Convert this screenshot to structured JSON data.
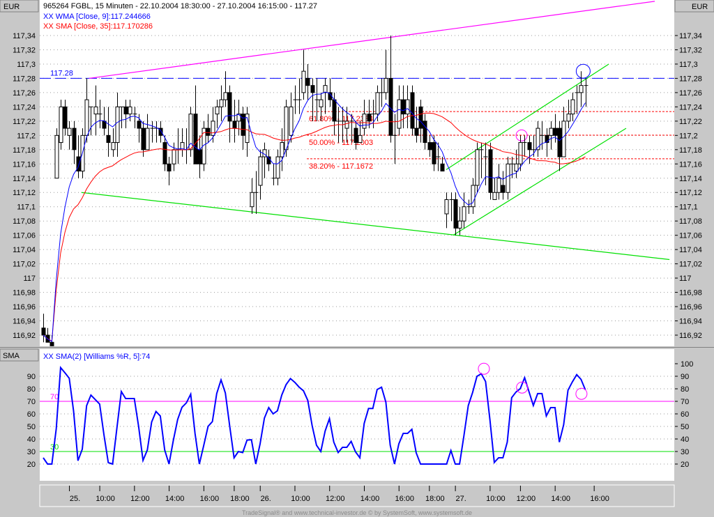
{
  "header": {
    "title": "965264  FGBL, 15 Minuten - 22.10.2004 18:30:00 - 27.10.2004 16:15:00 - 117.27",
    "wma_label": "XX WMA [Close, 9]:117.244666",
    "sma_label": "XX SMA [Close, 35]:117.170286",
    "currency_left": "EUR",
    "currency_right": "EUR",
    "lower_axis_label": "SMA",
    "lower_label": "XX SMA(2) [Williams %R, 5]:74"
  },
  "footer": "TradeSignal® and www.technical-investor.de © by SystemSoft, www.systemsoft.de",
  "colors": {
    "wma": "#0000ff",
    "sma": "#ff0000",
    "williams": "#0000ff",
    "resistance": "#ff00ff",
    "support": "#00e000",
    "fib": "#ff0000",
    "level_line": "#0000ff",
    "level70": "#ff00ff",
    "level30": "#00e000"
  },
  "chart_data": [
    {
      "type": "candlestick",
      "ylabel": "EUR",
      "ylim": [
        116.92,
        117.34
      ],
      "y_ticks": [
        "117,34",
        "117,32",
        "117,3",
        "117,28",
        "117,26",
        "117,24",
        "117,22",
        "117,2",
        "117,18",
        "117,16",
        "117,14",
        "117,12",
        "117,1",
        "117,08",
        "117,06",
        "117,04",
        "117,02",
        "117",
        "116,98",
        "116,96",
        "116,94",
        "116,92"
      ],
      "x_ticks": [
        {
          "label": "25.",
          "bar": 7
        },
        {
          "label": "10:00",
          "bar": 14
        },
        {
          "label": "12:00",
          "bar": 22
        },
        {
          "label": "14:00",
          "bar": 30
        },
        {
          "label": "16:00",
          "bar": 38
        },
        {
          "label": "18:00",
          "bar": 45
        },
        {
          "label": "26.",
          "bar": 51
        },
        {
          "label": "10:00",
          "bar": 59
        },
        {
          "label": "12:00",
          "bar": 67
        },
        {
          "label": "14:00",
          "bar": 75
        },
        {
          "label": "16:00",
          "bar": 83
        },
        {
          "label": "18:00",
          "bar": 90
        },
        {
          "label": "27.",
          "bar": 96
        },
        {
          "label": "10:00",
          "bar": 104
        },
        {
          "label": "12:00",
          "bar": 111
        },
        {
          "label": "14:00",
          "bar": 119
        },
        {
          "label": "16:00",
          "bar": 128
        }
      ],
      "ohlc": [
        [
          116.93,
          116.95,
          116.91,
          116.92
        ],
        [
          116.92,
          116.93,
          116.91,
          116.91
        ],
        [
          116.91,
          116.92,
          116.905,
          116.905
        ],
        [
          117.14,
          117.21,
          117.14,
          117.2
        ],
        [
          117.19,
          117.25,
          117.18,
          117.24
        ],
        [
          117.24,
          117.25,
          117.2,
          117.21
        ],
        [
          117.2,
          117.22,
          117.18,
          117.21
        ],
        [
          117.21,
          117.22,
          117.16,
          117.18
        ],
        [
          117.17,
          117.2,
          117.14,
          117.15
        ],
        [
          117.15,
          117.21,
          117.14,
          117.2
        ],
        [
          117.2,
          117.28,
          117.19,
          117.25
        ],
        [
          117.24,
          117.24,
          117.2,
          117.24
        ],
        [
          117.23,
          117.27,
          117.2,
          117.24
        ],
        [
          117.23,
          117.25,
          117.21,
          117.23
        ],
        [
          117.22,
          117.24,
          117.2,
          117.21
        ],
        [
          117.2,
          117.24,
          117.17,
          117.19
        ],
        [
          117.18,
          117.21,
          117.17,
          117.19
        ],
        [
          117.19,
          117.26,
          117.17,
          117.24
        ],
        [
          117.24,
          117.24,
          117.21,
          117.24
        ],
        [
          117.24,
          117.25,
          117.21,
          117.23
        ],
        [
          117.23,
          117.25,
          117.22,
          117.24
        ],
        [
          117.23,
          117.24,
          117.21,
          117.23
        ],
        [
          117.22,
          117.23,
          117.19,
          117.21
        ],
        [
          117.21,
          117.22,
          117.17,
          117.18
        ],
        [
          117.18,
          117.23,
          117.18,
          117.21
        ],
        [
          117.21,
          117.22,
          117.19,
          117.21
        ],
        [
          117.21,
          117.22,
          117.19,
          117.21
        ],
        [
          117.21,
          117.22,
          117.19,
          117.2
        ],
        [
          117.19,
          117.2,
          117.15,
          117.16
        ],
        [
          117.16,
          117.17,
          117.13,
          117.15
        ],
        [
          117.16,
          117.19,
          117.15,
          117.18
        ],
        [
          117.18,
          117.21,
          117.16,
          117.18
        ],
        [
          117.18,
          117.21,
          117.17,
          117.19
        ],
        [
          117.18,
          117.21,
          117.16,
          117.18
        ],
        [
          117.18,
          117.24,
          117.17,
          117.23
        ],
        [
          117.23,
          117.27,
          117.16,
          117.16
        ],
        [
          117.18,
          117.2,
          117.14,
          117.16
        ],
        [
          117.16,
          117.22,
          117.15,
          117.21
        ],
        [
          117.21,
          117.23,
          117.19,
          117.2
        ],
        [
          117.2,
          117.24,
          117.19,
          117.22
        ],
        [
          117.23,
          117.25,
          117.21,
          117.24
        ],
        [
          117.24,
          117.27,
          117.22,
          117.25
        ],
        [
          117.25,
          117.29,
          117.24,
          117.26
        ],
        [
          117.26,
          117.27,
          117.19,
          117.22
        ],
        [
          117.22,
          117.25,
          117.19,
          117.21
        ],
        [
          117.22,
          117.25,
          117.2,
          117.23
        ],
        [
          117.23,
          117.24,
          117.18,
          117.2
        ],
        [
          117.19,
          117.24,
          117.17,
          117.23
        ],
        [
          117.1,
          117.14,
          117.09,
          117.12
        ],
        [
          117.12,
          117.15,
          117.09,
          117.12
        ],
        [
          117.13,
          117.18,
          117.11,
          117.17
        ],
        [
          117.17,
          117.19,
          117.14,
          117.18
        ],
        [
          117.17,
          117.18,
          117.15,
          117.16
        ],
        [
          117.14,
          117.16,
          117.13,
          117.14
        ],
        [
          117.14,
          117.18,
          117.13,
          117.17
        ],
        [
          117.17,
          117.21,
          117.15,
          117.19
        ],
        [
          117.18,
          117.25,
          117.17,
          117.24
        ],
        [
          117.2,
          117.26,
          117.19,
          117.24
        ],
        [
          117.25,
          117.27,
          117.23,
          117.25
        ],
        [
          117.25,
          117.28,
          117.23,
          117.25
        ],
        [
          117.26,
          117.32,
          117.25,
          117.29
        ],
        [
          117.28,
          117.3,
          117.25,
          117.27
        ],
        [
          117.27,
          117.28,
          117.22,
          117.26
        ],
        [
          117.25,
          117.28,
          117.22,
          117.25
        ],
        [
          117.24,
          117.26,
          117.22,
          117.25
        ],
        [
          117.26,
          117.28,
          117.23,
          117.27
        ],
        [
          117.26,
          117.28,
          117.24,
          117.25
        ],
        [
          117.25,
          117.26,
          117.2,
          117.22
        ],
        [
          117.22,
          117.24,
          117.19,
          117.22
        ],
        [
          117.22,
          117.24,
          117.19,
          117.22
        ],
        [
          117.21,
          117.24,
          117.19,
          117.22
        ],
        [
          117.22,
          117.23,
          117.19,
          117.22
        ],
        [
          117.21,
          117.22,
          117.18,
          117.19
        ],
        [
          117.19,
          117.22,
          117.19,
          117.2
        ],
        [
          117.21,
          117.25,
          117.2,
          117.23
        ],
        [
          117.23,
          117.25,
          117.21,
          117.22
        ],
        [
          117.23,
          117.25,
          117.21,
          117.23
        ],
        [
          117.23,
          117.27,
          117.22,
          117.26
        ],
        [
          117.26,
          117.28,
          117.24,
          117.26
        ],
        [
          117.26,
          117.32,
          117.25,
          117.28
        ],
        [
          117.28,
          117.34,
          117.19,
          117.2
        ],
        [
          117.2,
          117.23,
          117.16,
          117.2
        ],
        [
          117.21,
          117.27,
          117.2,
          117.25
        ],
        [
          117.25,
          117.27,
          117.21,
          117.23
        ],
        [
          117.23,
          117.27,
          117.21,
          117.25
        ],
        [
          117.26,
          117.27,
          117.2,
          117.21
        ],
        [
          117.21,
          117.24,
          117.19,
          117.2
        ],
        [
          117.24,
          117.25,
          117.19,
          117.21
        ],
        [
          117.22,
          117.23,
          117.18,
          117.19
        ],
        [
          117.19,
          117.2,
          117.17,
          117.18
        ],
        [
          117.19,
          117.2,
          117.15,
          117.16
        ],
        [
          117.17,
          117.19,
          117.15,
          117.17
        ],
        [
          117.16,
          117.17,
          117.15,
          117.15
        ],
        [
          117.09,
          117.12,
          117.07,
          117.11
        ],
        [
          117.11,
          117.12,
          117.08,
          117.11
        ],
        [
          117.11,
          117.12,
          117.06,
          117.07
        ],
        [
          117.07,
          117.1,
          117.06,
          117.08
        ],
        [
          117.08,
          117.12,
          117.07,
          117.1
        ],
        [
          117.1,
          117.11,
          117.09,
          117.1
        ],
        [
          117.1,
          117.14,
          117.09,
          117.13
        ],
        [
          117.13,
          117.19,
          117.12,
          117.18
        ],
        [
          117.18,
          117.19,
          117.14,
          117.18
        ],
        [
          117.17,
          117.19,
          117.13,
          117.17
        ],
        [
          117.18,
          117.19,
          117.11,
          117.12
        ],
        [
          117.11,
          117.14,
          117.11,
          117.12
        ],
        [
          117.12,
          117.16,
          117.11,
          117.14
        ],
        [
          117.13,
          117.15,
          117.11,
          117.12
        ],
        [
          117.12,
          117.17,
          117.11,
          117.16
        ],
        [
          117.16,
          117.17,
          117.14,
          117.16
        ],
        [
          117.15,
          117.18,
          117.14,
          117.16
        ],
        [
          117.16,
          117.2,
          117.15,
          117.19
        ],
        [
          117.19,
          117.2,
          117.17,
          117.19
        ],
        [
          117.19,
          117.2,
          117.16,
          117.18
        ],
        [
          117.18,
          117.2,
          117.17,
          117.18
        ],
        [
          117.18,
          117.22,
          117.17,
          117.21
        ],
        [
          117.2,
          117.22,
          117.18,
          117.2
        ],
        [
          117.2,
          117.21,
          117.17,
          117.19
        ],
        [
          117.2,
          117.22,
          117.18,
          117.21
        ],
        [
          117.21,
          117.23,
          117.19,
          117.2
        ],
        [
          117.21,
          117.22,
          117.15,
          117.17
        ],
        [
          117.17,
          117.24,
          117.17,
          117.22
        ],
        [
          117.22,
          117.25,
          117.21,
          117.23
        ],
        [
          117.23,
          117.26,
          117.22,
          117.25
        ],
        [
          117.26,
          117.27,
          117.23,
          117.26
        ],
        [
          117.26,
          117.29,
          117.24,
          117.27
        ],
        [
          117.27,
          117.28,
          117.24,
          117.27
        ]
      ],
      "indicators": [
        {
          "name": "WMA [Close, 9]",
          "type": "wma",
          "period": 9,
          "last": 117.244666
        },
        {
          "name": "SMA [Close, 35]",
          "type": "sma",
          "period": 35,
          "last": 117.170286
        }
      ],
      "horizontal_level": {
        "label": "117.28",
        "value": 117.28
      },
      "fibonacci": [
        {
          "label": "61.80% - 117.2334",
          "value": 117.2334
        },
        {
          "label": "50.00% - 117.2003",
          "value": 117.2003
        },
        {
          "label": "38.20% - 117.1672",
          "value": 117.1672
        }
      ],
      "trendlines": [
        {
          "kind": "resistance",
          "from": {
            "bar": 10.6,
            "price": 117.28
          },
          "to": {
            "bar": 141,
            "price": 117.388
          }
        },
        {
          "kind": "support",
          "from": {
            "bar": 8.8,
            "price": 117.12
          },
          "to": {
            "bar": 144.4,
            "price": 117.026
          }
        },
        {
          "kind": "channel-upper",
          "from": {
            "bar": 92.9,
            "price": 117.152
          },
          "to": {
            "bar": 130.4,
            "price": 117.3
          }
        },
        {
          "kind": "channel-lower",
          "from": {
            "bar": 94.5,
            "price": 117.06
          },
          "to": {
            "bar": 134.4,
            "price": 117.21
          }
        }
      ],
      "markers": [
        {
          "color": "#ff00ff",
          "bar": 110.3,
          "price": 117.2
        },
        {
          "color": "#0000ff",
          "bar": 124.5,
          "price": 117.29
        }
      ]
    },
    {
      "type": "line",
      "ylabel": "SMA",
      "ylim": [
        20,
        100
      ],
      "y_ticks": [
        "100",
        "90",
        "80",
        "70",
        "60",
        "50",
        "40",
        "30",
        "20"
      ],
      "levels": [
        {
          "label": "70",
          "value": 70
        },
        {
          "label": "30",
          "value": 30
        }
      ],
      "period_wr": 5,
      "period_sma": 2,
      "last": 74,
      "markers": [
        {
          "bar": 101.6,
          "value": 96
        },
        {
          "bar": 110.4,
          "value": 81
        },
        {
          "bar": 124.1,
          "value": 76
        }
      ]
    }
  ]
}
